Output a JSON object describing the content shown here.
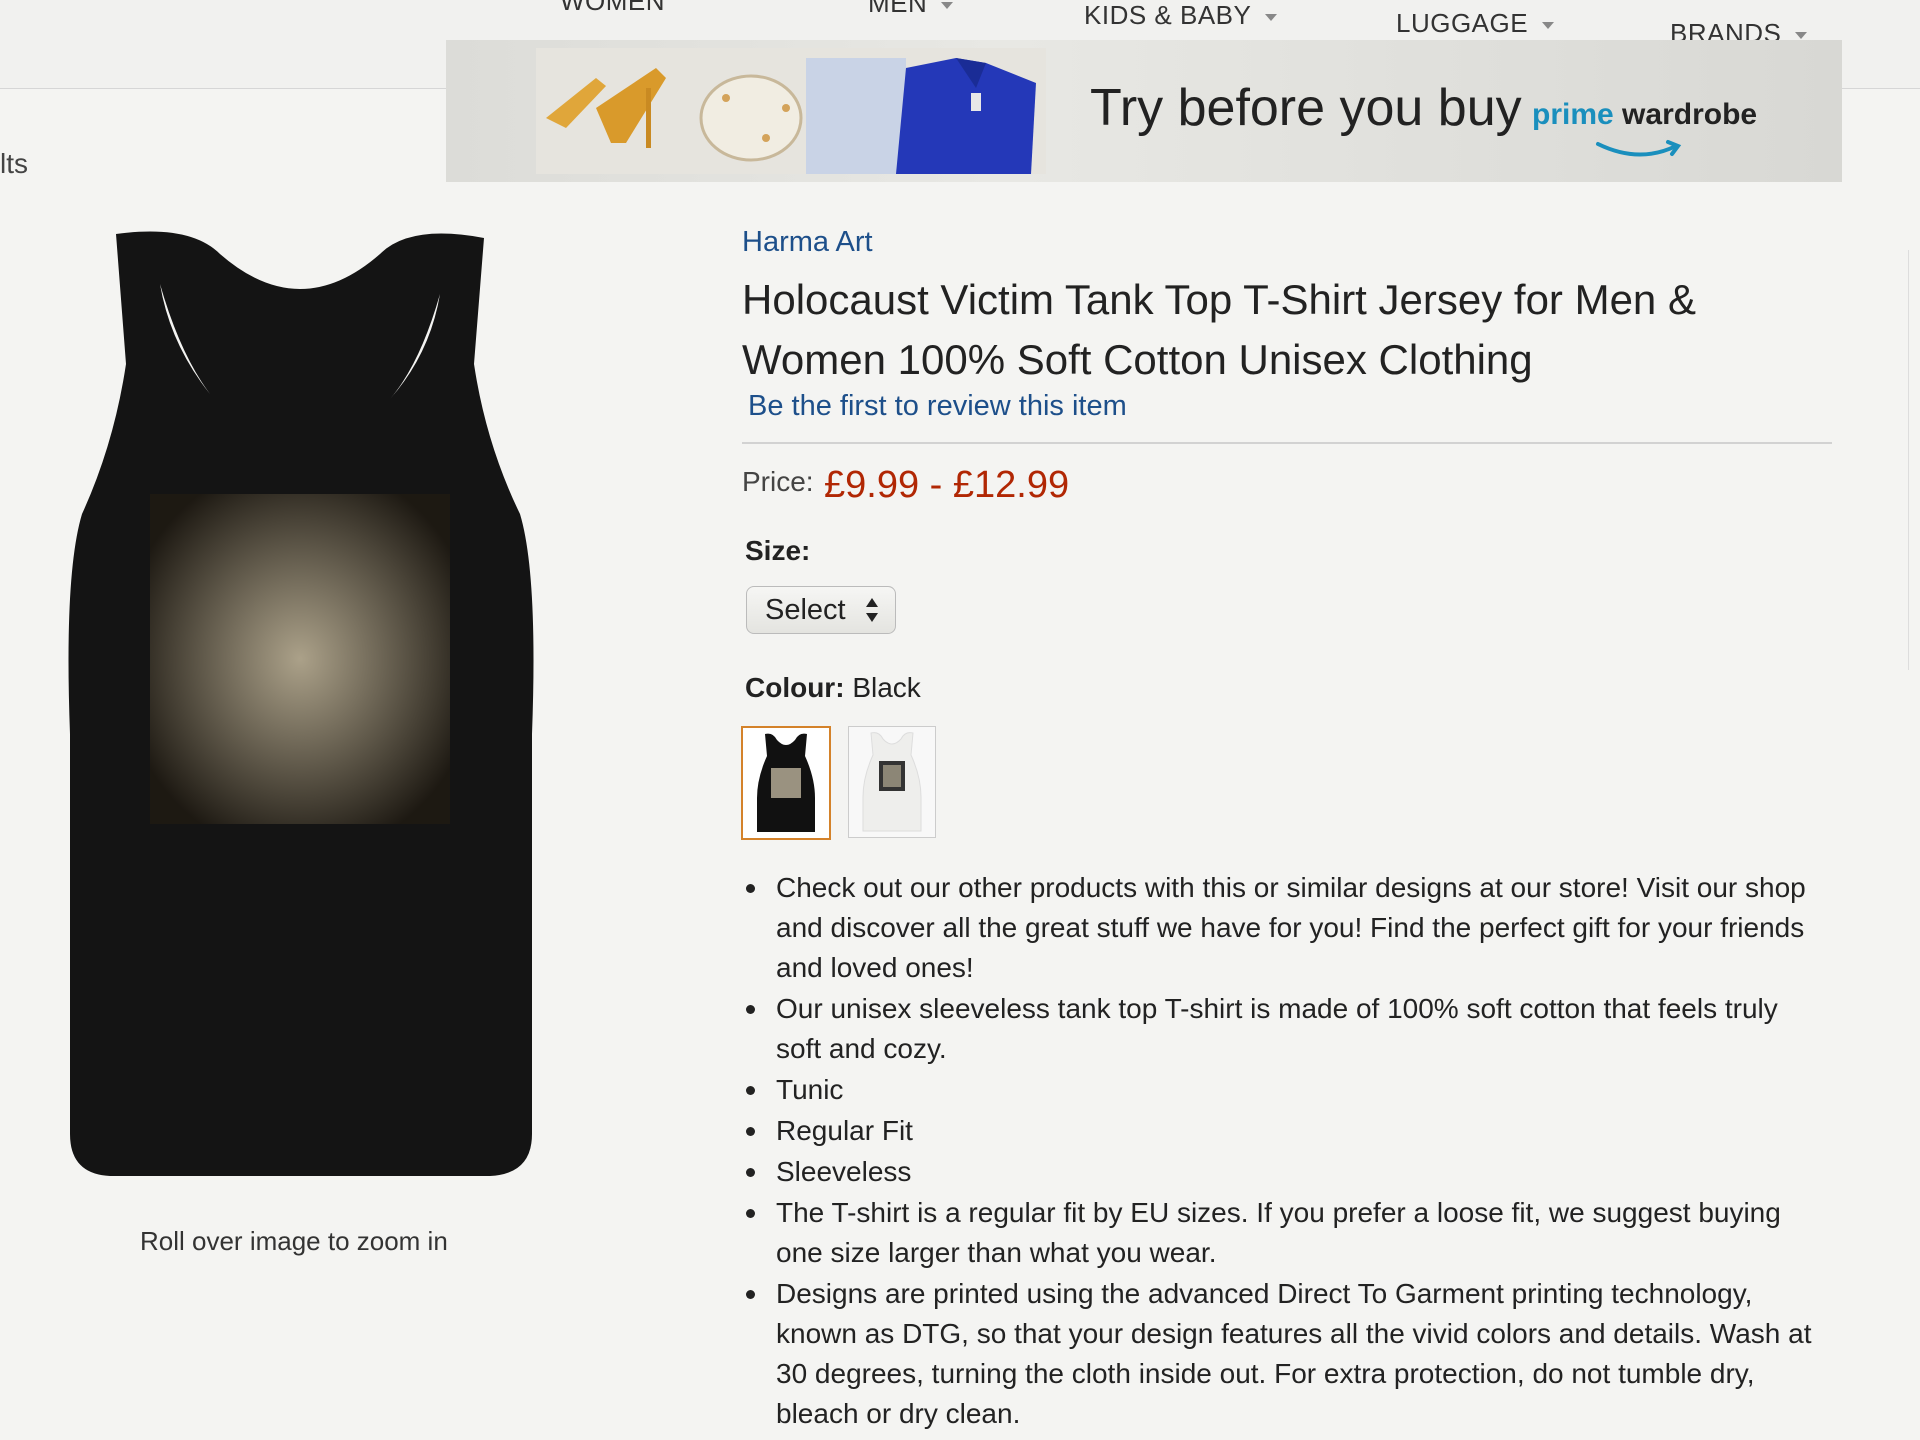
{
  "nav": {
    "items": [
      {
        "label": "WOMEN"
      },
      {
        "label": "MEN"
      },
      {
        "label": "KIDS & BABY"
      },
      {
        "label": "LUGGAGE"
      },
      {
        "label": "BRANDS"
      }
    ]
  },
  "sidebar": {
    "crumb": "lts"
  },
  "banner": {
    "headline": "Try before you buy",
    "prime": "prime",
    "wardrobe": "wardrobe"
  },
  "gallery": {
    "zoom_hint": "Roll over image to zoom in"
  },
  "product": {
    "brand": "Harma Art",
    "title": "Holocaust Victim Tank Top T-Shirt Jersey for Men & Women 100% Soft Cotton Unisex Clothing",
    "review_link": "Be the first to review this item",
    "price_label": "Price:",
    "price": "£9.99 - £12.99",
    "size_label": "Size:",
    "size_selected": "Select",
    "colour_label": "Colour:",
    "colour_value": "Black",
    "swatches": [
      {
        "colour": "#111111",
        "selected": true
      },
      {
        "colour": "#f2f2f2",
        "selected": false
      }
    ],
    "bullets": [
      "Check out our other products with this or similar designs at our store! Visit our shop and discover all the great stuff we have for you! Find the perfect gift for your friends and loved ones!",
      "Our unisex sleeveless tank top T-shirt is made of 100% soft cotton that feels truly soft and cozy.",
      "Tunic",
      "Regular Fit",
      "Sleeveless",
      "The T-shirt is a regular fit by EU sizes. If you prefer a loose fit, we suggest buying one size larger than what you wear.",
      "Designs are printed using the advanced Direct To Garment printing technology, known as DTG, so that your design features all the vivid colors and details. Wash at 30 degrees, turning the cloth inside out. For extra protection, do not tumble dry, bleach or dry clean."
    ]
  },
  "colors": {
    "link": "#1d4f8a",
    "price": "#b12704",
    "prime_blue": "#1a8fbd",
    "selected_border": "#d4822a"
  },
  "icons": [
    "dropdown-caret-icon",
    "select-arrows-icon",
    "amazon-smile-icon"
  ]
}
